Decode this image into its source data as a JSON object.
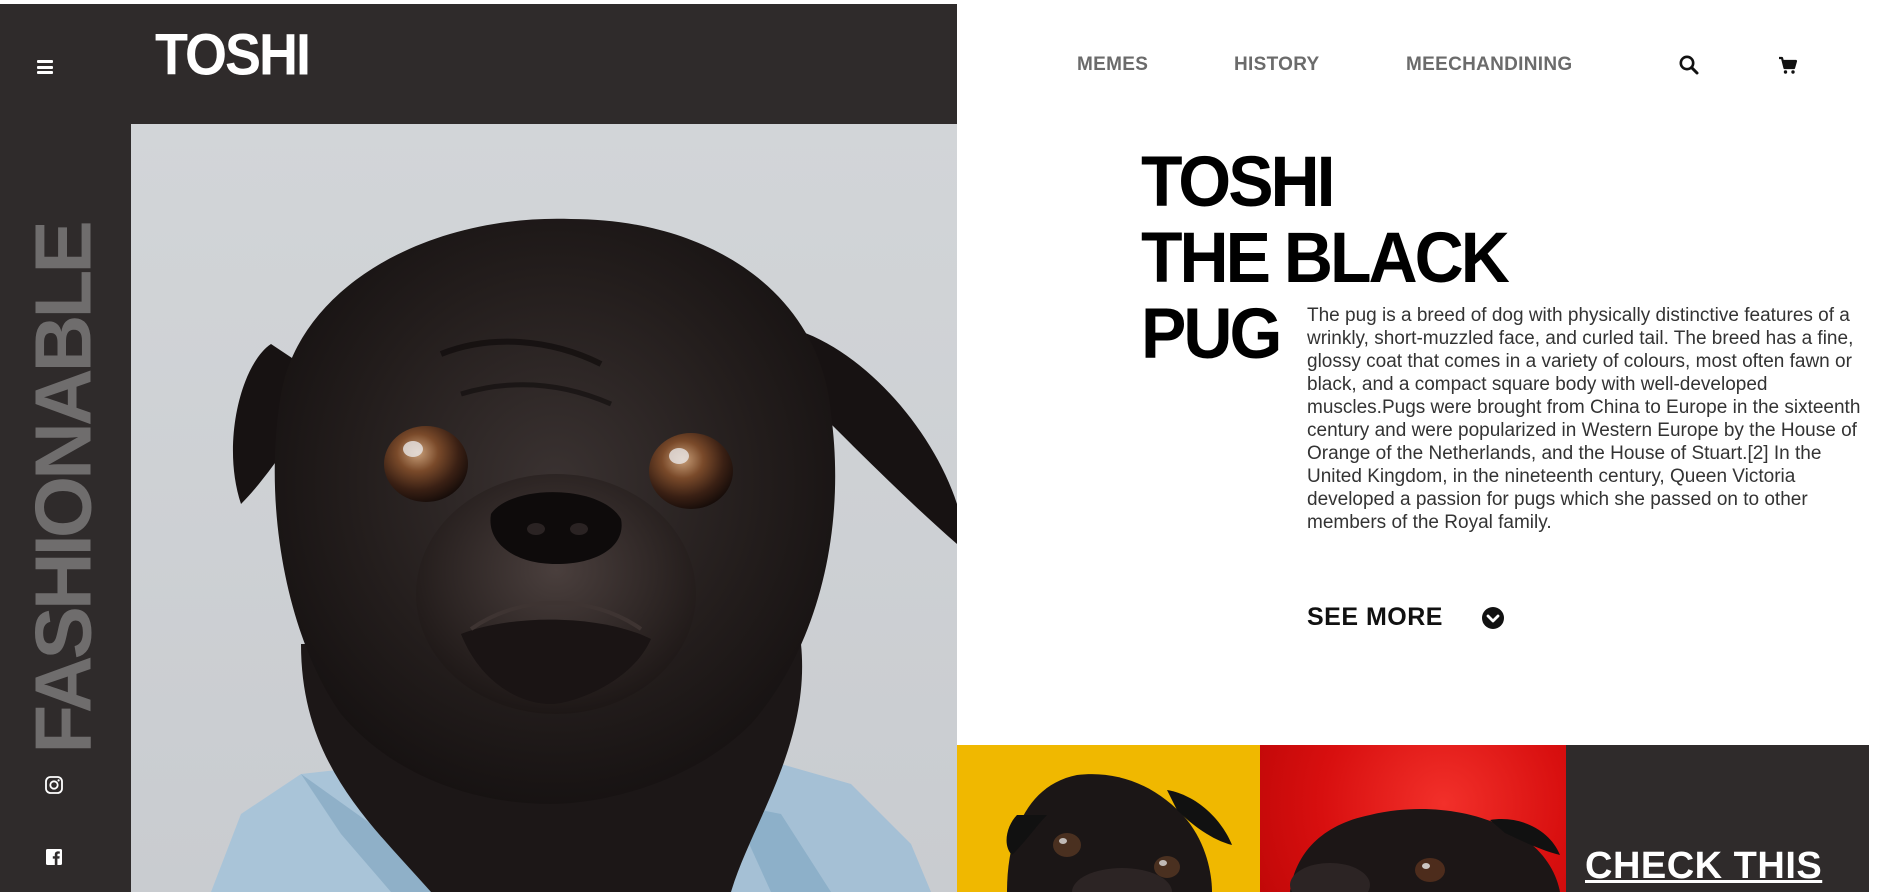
{
  "brand": {
    "name": "TOSHI"
  },
  "sidebar": {
    "vertical_text": "FASHIONABLE",
    "icons": [
      "menu-icon",
      "instagram-icon",
      "facebook-icon"
    ]
  },
  "nav": {
    "items": [
      {
        "label": "MEMES"
      },
      {
        "label": "HISTORY"
      },
      {
        "label": "MEECHANDINING"
      }
    ],
    "icons": [
      "search-icon",
      "cart-icon"
    ]
  },
  "hero": {
    "title_lines": [
      "TOSHI",
      "THE BLACK",
      "PUG"
    ],
    "description": "The pug is a breed of dog with physically distinctive features of a wrinkly, short-muzzled face, and curled tail. The breed has a fine, glossy coat that comes in a variety of colours, most often fawn or black, and a compact square body with well-developed muscles.Pugs were brought from China to Europe in the sixteenth century and were popularized in Western Europe by the House of Orange of the Netherlands, and the House of Stuart.[2] In the United Kingdom, in the nineteenth century, Queen Victoria developed a passion for pugs which she passed on to other members of the Royal family.",
    "see_more_label": "SEE MORE"
  },
  "promo": {
    "check_label": "CHECK THIS"
  },
  "colors": {
    "dark": "#2f2b2b",
    "vertical_text": "#6f6d6d",
    "tile_yellow": "#f0b800",
    "tile_red": "#d80f0f"
  }
}
